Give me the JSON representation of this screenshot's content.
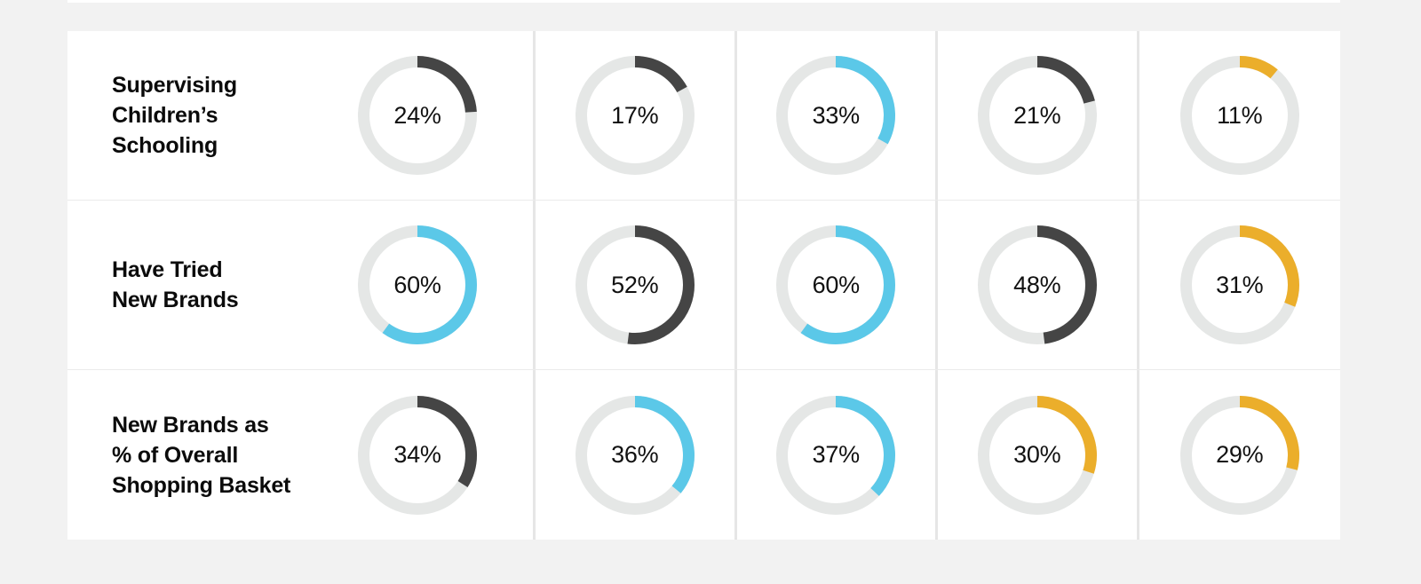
{
  "theme": {
    "page_background": "#f2f2f2",
    "card_background": "#ffffff",
    "track_color": "#e5e7e6",
    "divider_color": "#e6e6e6",
    "row_divider_color": "#ebebeb",
    "label_color": "#0b0b0b",
    "value_color": "#111111",
    "series_colors": {
      "dark": "#454545",
      "blue": "#5bc8e8",
      "amber": "#ebae2b"
    }
  },
  "chart_data": {
    "type": "pie",
    "title": "",
    "subtitle": "",
    "xlabel": "",
    "ylabel": "",
    "legend_position": "none",
    "grid": false,
    "value_unit": "%",
    "value_range": [
      0,
      100
    ],
    "chart_style": "donut",
    "rows": [
      {
        "label": "Supervising\nChildren’s\nSchooling",
        "cells": [
          {
            "value": 24,
            "display": "24%",
            "color": "#454545",
            "color_name": "dark"
          },
          {
            "value": 17,
            "display": "17%",
            "color": "#454545",
            "color_name": "dark"
          },
          {
            "value": 33,
            "display": "33%",
            "color": "#5bc8e8",
            "color_name": "blue"
          },
          {
            "value": 21,
            "display": "21%",
            "color": "#454545",
            "color_name": "dark"
          },
          {
            "value": 11,
            "display": "11%",
            "color": "#ebae2b",
            "color_name": "amber"
          }
        ]
      },
      {
        "label": "Have Tried\nNew Brands",
        "cells": [
          {
            "value": 60,
            "display": "60%",
            "color": "#5bc8e8",
            "color_name": "blue"
          },
          {
            "value": 52,
            "display": "52%",
            "color": "#454545",
            "color_name": "dark"
          },
          {
            "value": 60,
            "display": "60%",
            "color": "#5bc8e8",
            "color_name": "blue"
          },
          {
            "value": 48,
            "display": "48%",
            "color": "#454545",
            "color_name": "dark"
          },
          {
            "value": 31,
            "display": "31%",
            "color": "#ebae2b",
            "color_name": "amber"
          }
        ]
      },
      {
        "label": "New Brands as\n% of Overall\nShopping Basket",
        "cells": [
          {
            "value": 34,
            "display": "34%",
            "color": "#454545",
            "color_name": "dark"
          },
          {
            "value": 36,
            "display": "36%",
            "color": "#5bc8e8",
            "color_name": "blue"
          },
          {
            "value": 37,
            "display": "37%",
            "color": "#5bc8e8",
            "color_name": "blue"
          },
          {
            "value": 30,
            "display": "30%",
            "color": "#ebae2b",
            "color_name": "amber"
          },
          {
            "value": 29,
            "display": "29%",
            "color": "#ebae2b",
            "color_name": "amber"
          }
        ]
      }
    ]
  }
}
